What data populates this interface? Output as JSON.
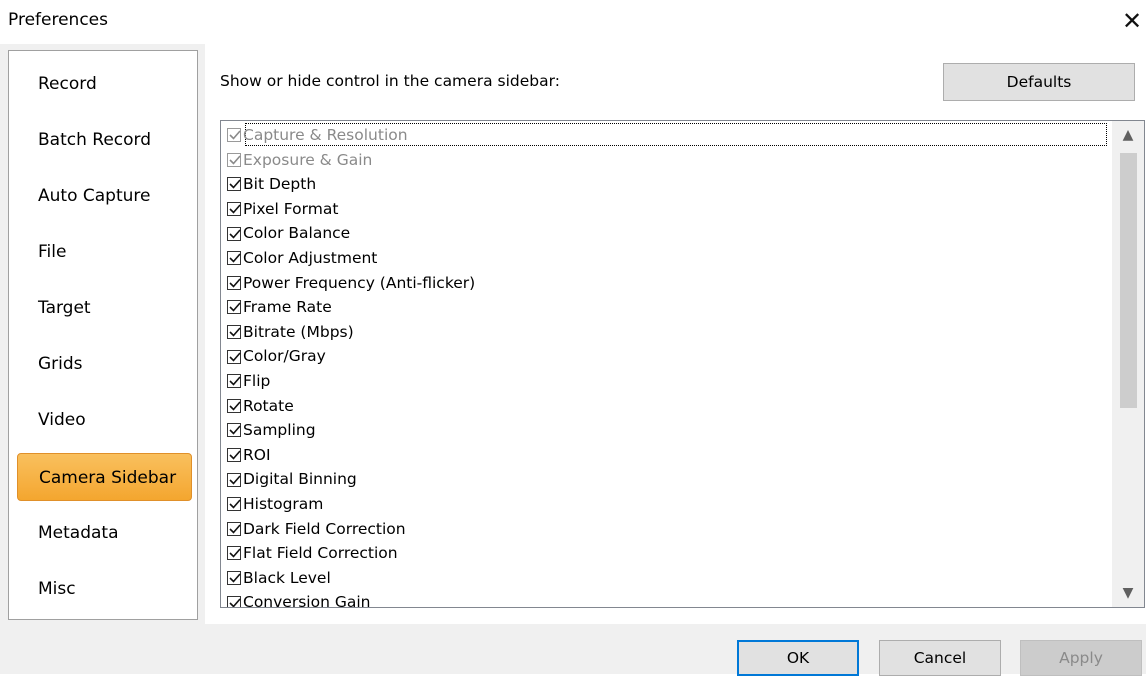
{
  "window": {
    "title": "Preferences",
    "close_glyph": "✕"
  },
  "sidebar": {
    "items": [
      {
        "label": "Record"
      },
      {
        "label": "Batch Record"
      },
      {
        "label": "Auto Capture"
      },
      {
        "label": "File"
      },
      {
        "label": "Target"
      },
      {
        "label": "Grids"
      },
      {
        "label": "Video"
      },
      {
        "label": "Camera Sidebar",
        "active": true
      },
      {
        "label": "Metadata"
      },
      {
        "label": "Misc"
      }
    ]
  },
  "content": {
    "prompt": "Show or hide control in the camera sidebar:",
    "defaults_label": "Defaults",
    "items": [
      {
        "label": "Capture & Resolution",
        "checked": true,
        "disabled": true
      },
      {
        "label": "Exposure & Gain",
        "checked": true,
        "disabled": true
      },
      {
        "label": "Bit Depth",
        "checked": true
      },
      {
        "label": "Pixel Format",
        "checked": true
      },
      {
        "label": "Color Balance",
        "checked": true
      },
      {
        "label": "Color Adjustment",
        "checked": true
      },
      {
        "label": "Power Frequency (Anti-flicker)",
        "checked": true
      },
      {
        "label": "Frame Rate",
        "checked": true
      },
      {
        "label": "Bitrate (Mbps)",
        "checked": true
      },
      {
        "label": "Color/Gray",
        "checked": true
      },
      {
        "label": "Flip",
        "checked": true
      },
      {
        "label": "Rotate",
        "checked": true
      },
      {
        "label": "Sampling",
        "checked": true
      },
      {
        "label": "ROI",
        "checked": true
      },
      {
        "label": "Digital Binning",
        "checked": true
      },
      {
        "label": "Histogram",
        "checked": true
      },
      {
        "label": "Dark Field Correction",
        "checked": true
      },
      {
        "label": "Flat Field Correction",
        "checked": true
      },
      {
        "label": "Black Level",
        "checked": true
      },
      {
        "label": "Conversion Gain",
        "checked": true
      }
    ],
    "scroll": {
      "up_glyph": "▲",
      "down_glyph": "▼"
    }
  },
  "footer": {
    "ok_label": "OK",
    "cancel_label": "Cancel",
    "apply_label": "Apply"
  }
}
